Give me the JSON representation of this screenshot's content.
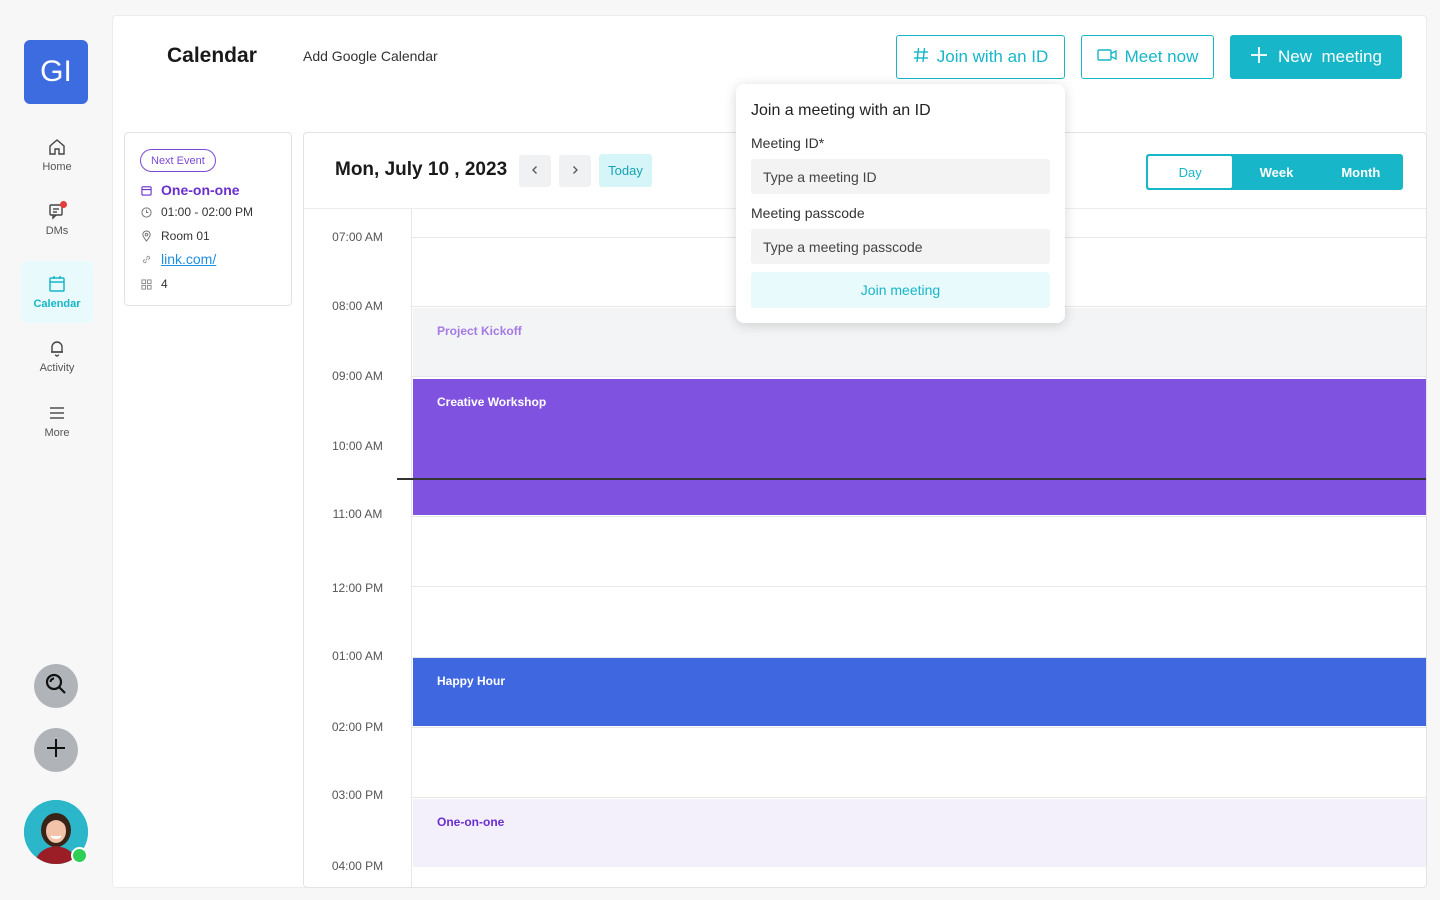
{
  "rail": {
    "org_initials": "GI",
    "items": [
      {
        "label": "Home",
        "icon": "home-icon"
      },
      {
        "label": "DMs",
        "icon": "chat-icon"
      },
      {
        "label": "Calendar",
        "icon": "calendar-icon"
      },
      {
        "label": "Activity",
        "icon": "bell-icon"
      },
      {
        "label": "More",
        "icon": "menu-icon"
      }
    ],
    "active": "Calendar"
  },
  "header": {
    "title": "Calendar",
    "add_google": "Add Google Calendar",
    "join_id_label": "Join with an ID",
    "meet_now_label": "Meet now",
    "new_meeting_label": "New  meeting"
  },
  "next_event": {
    "badge": "Next Event",
    "title": "One-on-one",
    "time": "01:00 - 02:00 PM",
    "room": "Room 01",
    "link": "link.com/",
    "attendees": "4"
  },
  "calendar": {
    "date": "Mon, July 10 , 2023",
    "today_label": "Today",
    "views": [
      "Day",
      "Week",
      "Month"
    ],
    "selected_view": "Day",
    "times": [
      "07:00 AM",
      "08:00 AM",
      "09:00 AM",
      "10:00 AM",
      "11:00 AM",
      "12:00 PM",
      "01:00 AM",
      "02:00 PM",
      "03:00 PM",
      "04:00 PM"
    ],
    "events": [
      {
        "title": "Project Kickoff",
        "bg": "#f3f4f5",
        "color": "#a57ae4"
      },
      {
        "title": "Creative Workshop",
        "bg": "#8052e0",
        "color": "#ffffff"
      },
      {
        "title": "Happy Hour",
        "bg": "#3f68e0",
        "color": "#ffffff"
      },
      {
        "title": "One-on-one",
        "bg": "#f3f0fc",
        "color": "#6a2ed0"
      }
    ]
  },
  "popover": {
    "title": "Join a meeting with an ID",
    "meeting_id_label": "Meeting ID*",
    "meeting_id_placeholder": "Type a meeting ID",
    "passcode_label": "Meeting passcode",
    "passcode_placeholder": "Type a meeting passcode",
    "join_label": "Join meeting"
  },
  "colors": {
    "accent": "#17b6c8",
    "brand": "#3d6be0",
    "purple": "#8052e0"
  }
}
